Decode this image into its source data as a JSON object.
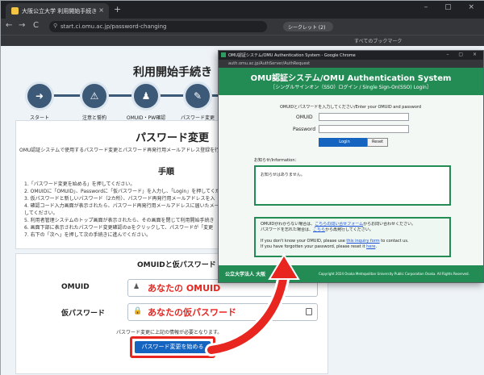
{
  "colors": {
    "accent_red": "#e8251f",
    "button_blue": "#1565c0",
    "omu_green": "#238c55",
    "step_navy": "#3c5a78"
  },
  "browser": {
    "tab_title": "大阪公立大学 利用開始手続き",
    "tab_close": "×",
    "new_tab": "+",
    "window_controls": "– ▢ ×",
    "back": "←",
    "forward": "→",
    "reload": "C",
    "url": "start.ci.omu.ac.jp/password-changing",
    "incognito_label": "シークレット (2)",
    "bookmarks_label": "すべてのブックマーク",
    "icons": {
      "lock": "⚲",
      "incognito": "incognito-icon"
    }
  },
  "page": {
    "title": "利用開始手続き",
    "steps": [
      {
        "icon": "➜",
        "label": "スタート"
      },
      {
        "icon": "⚠",
        "label": "注意と誓約"
      },
      {
        "icon": "♟",
        "label": "OMUID・PW確認"
      },
      {
        "icon": "✎",
        "label": "パスワード変更"
      }
    ],
    "password_change": {
      "title": "パスワード変更",
      "description": "OMU認証システムで使用するパスワード変更とパスワード再発行用メールアドレス登録を行",
      "procedure_title": "手順",
      "procedure": [
        "1.「パスワード変更を始める」を押してください。",
        "2. OMUIDに「OMUID」、Passwordに「仮パスワード」を入力し、「Login」を押してくだ",
        "3. 仮パスワードと新しいパスワード（2カ所）、パスワード再発行用メールアドレスを入",
        "4. 確認コード入力画面が表示されたら、パスワード再発行用メールアドレスに届いたメー",
        "   してください。",
        "5. 利用者管理システムのトップ画面が表示されたら、その画面を閉じて利用開始手続き",
        "6. 画面下部に表示されたパスワード変更確認の⊘をクリックして、パスワードが「変更",
        "7. 右下の「次へ」を押して次の手続きに進んでください。"
      ]
    },
    "credentials": {
      "title": "OMUIDと仮パスワード",
      "omuid_label": "OMUID",
      "omuid_value": "あなたの OMUID",
      "temp_password_label": "仮パスワード",
      "temp_password_value": "あなたの仮パスワード",
      "note": "パスワード変更に上記の情報が必要となります。",
      "start_button": "パスワード変更を始める",
      "user_icon": "♟",
      "lock_icon": "🔒"
    }
  },
  "popup": {
    "window_title": "OMU認証システム/OMU Authentication System - Google Chrome",
    "window_controls": "– ▢ ×",
    "url": "auth.omu.ac.jp/AuthServer/AuthRequest",
    "header_title": "OMU認証システム/OMU Authentication System",
    "header_subtitle": "［シングルサインオン（SSO）ログイン / Single Sign-On(SSO) Login］",
    "instruction": "OMUIDとパスワードを入力してください/Enter your OMUID and password",
    "omuid_label": "OMUID",
    "password_label": "Password",
    "login_button": "Login",
    "reset_button": "Reset",
    "info_label": "お知らせ/Information：",
    "info_text": "お知らせはありません。",
    "help_lines": [
      {
        "pre": "OMUIDがわからない場合は、",
        "link": "こちらの問い合せフォーム",
        "post": "からお問い合わせください。"
      },
      {
        "pre": "パスワードを忘れた場合は、",
        "link": "こちら",
        "post": "から再発行してください。"
      },
      {
        "pre": "",
        "link": "",
        "post": ""
      },
      {
        "pre": "If you don't know your OMUID, please use ",
        "link": "this inquiry form",
        "post": " to contact us."
      },
      {
        "pre": "If you have forgotten your password, please reset it ",
        "link": "here",
        "post": "."
      }
    ],
    "footer_org": "公立大学法人 大阪",
    "footer_copyright": "Copyright 2024 Osaka Metropolitan University Public Corporation Osaka. All Rights Reserved."
  }
}
